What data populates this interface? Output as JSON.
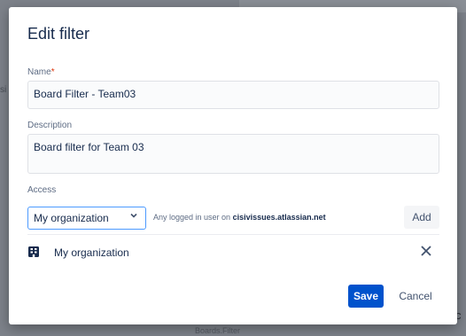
{
  "background": {
    "left_fragment": "si",
    "right_fragment": "c",
    "bottom_fragment": "Boards.Filter"
  },
  "dialog": {
    "title": "Edit filter",
    "name": {
      "label": "Name",
      "required_marker": "*",
      "value": "Board Filter - Team03"
    },
    "description": {
      "label": "Description",
      "value": "Board filter for Team 03"
    },
    "access": {
      "label": "Access",
      "selected": "My organization",
      "info_prefix": "Any logged in user on",
      "info_domain": "cisivissues.atlassian.net",
      "add_label": "Add"
    },
    "shared_with": [
      {
        "label": "My organization",
        "icon": "building-icon"
      }
    ],
    "actions": {
      "save_label": "Save",
      "cancel_label": "Cancel"
    }
  },
  "colors": {
    "primary": "#0052cc",
    "focus_border": "#4c9aff",
    "required": "#de350b"
  }
}
